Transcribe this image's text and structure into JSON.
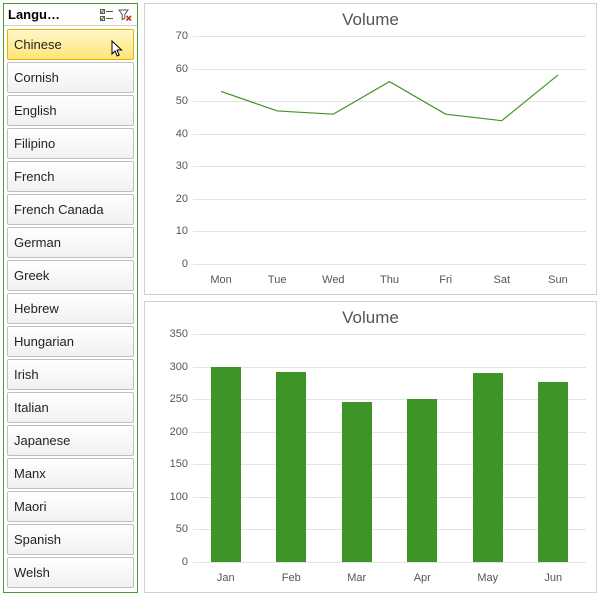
{
  "slicer": {
    "title": "Langu…",
    "multi_select_icon": "multi-select-icon",
    "clear_filter_icon": "clear-filter-icon",
    "items": [
      {
        "label": "Chinese",
        "selected": true,
        "cursor": true
      },
      {
        "label": "Cornish"
      },
      {
        "label": "English"
      },
      {
        "label": "Filipino"
      },
      {
        "label": "French"
      },
      {
        "label": "French Canada"
      },
      {
        "label": "German"
      },
      {
        "label": "Greek"
      },
      {
        "label": "Hebrew"
      },
      {
        "label": "Hungarian"
      },
      {
        "label": "Irish"
      },
      {
        "label": "Italian"
      },
      {
        "label": "Japanese"
      },
      {
        "label": "Manx"
      },
      {
        "label": "Maori"
      },
      {
        "label": "Spanish"
      },
      {
        "label": "Welsh"
      }
    ]
  },
  "chart_data": [
    {
      "type": "line",
      "title": "Volume",
      "categories": [
        "Mon",
        "Tue",
        "Wed",
        "Thu",
        "Fri",
        "Sat",
        "Sun"
      ],
      "values": [
        53,
        47,
        46,
        56,
        46,
        44,
        58
      ],
      "ylim": [
        0,
        70
      ],
      "yticks": [
        0,
        10,
        20,
        30,
        40,
        50,
        60,
        70
      ],
      "series_color": "#3f9428"
    },
    {
      "type": "bar",
      "title": "Volume",
      "categories": [
        "Jan",
        "Feb",
        "Mar",
        "Apr",
        "May",
        "Jun"
      ],
      "values": [
        299,
        292,
        245,
        250,
        290,
        277
      ],
      "ylim": [
        0,
        350
      ],
      "yticks": [
        0,
        50,
        100,
        150,
        200,
        250,
        300,
        350
      ],
      "series_color": "#3f9428"
    }
  ]
}
